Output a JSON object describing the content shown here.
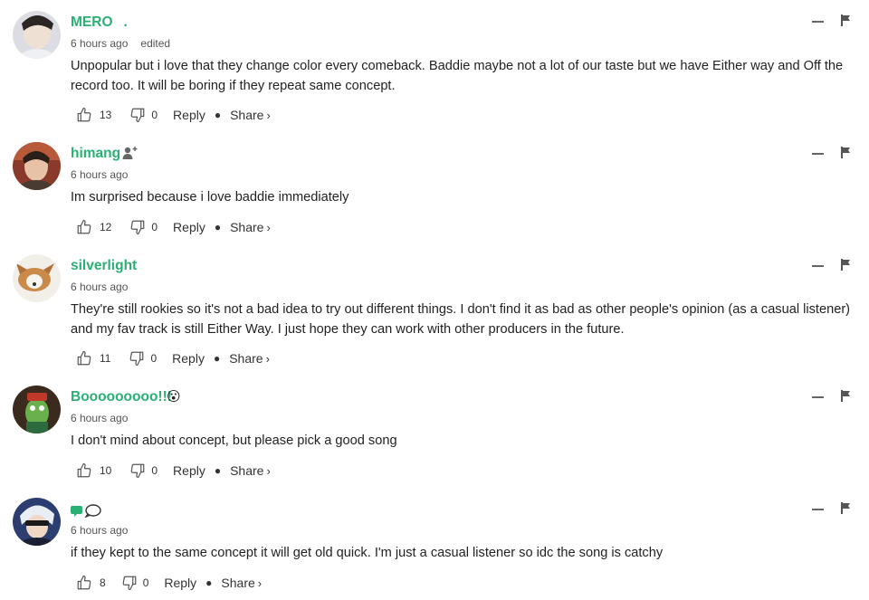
{
  "comments": [
    {
      "username": "MERO",
      "username_suffix": ".",
      "time": "6 hours ago",
      "edited": "edited",
      "text": "Unpopular but i love that they change color every comeback. Baddie maybe not a lot of our taste but we have Either way and Off the record too. It will be boring if they repeat same concept.",
      "likes": "13",
      "dislikes": "0",
      "reply_label": "Reply",
      "share_label": "Share",
      "share_chevron": "›"
    },
    {
      "username": "himang",
      "time": "6 hours ago",
      "text": "Im surprised because i love baddie immediately",
      "likes": "12",
      "dislikes": "0",
      "reply_label": "Reply",
      "share_label": "Share",
      "share_chevron": "›",
      "badge_icon": "add-friend-icon"
    },
    {
      "username": "silverlight",
      "time": "6 hours ago",
      "text": "They're still rookies so it's not a bad idea to try out different things. I don't find it as bad as other people's opinion (as a casual listener) and my fav track is still Either Way. I just hope they can work with other producers in the future.",
      "likes": "11",
      "dislikes": "0",
      "reply_label": "Reply",
      "share_label": "Share",
      "share_chevron": "›"
    },
    {
      "username": "Booooooooo!!!",
      "time": "6 hours ago",
      "text": "I don't mind about concept, but please pick a good song",
      "likes": "10",
      "dislikes": "0",
      "reply_label": "Reply",
      "share_label": "Share",
      "share_chevron": "›",
      "badge_icon": "surprised-face-emoji",
      "badge_glyph": "😮"
    },
    {
      "username": "",
      "time": "6 hours ago",
      "text": "if they kept to the same concept it will get old quick. I'm just a casual listener so idc the song is catchy",
      "likes": "8",
      "dislikes": "0",
      "reply_label": "Reply",
      "share_label": "Share",
      "share_chevron": "›",
      "badge_icon": "speech-bubbles-icon"
    }
  ],
  "colors": {
    "username": "#2aaf74",
    "text": "#222222",
    "meta": "#555555",
    "icon": "#555555"
  },
  "icons": {
    "like": "thumbs-up-icon",
    "dislike": "thumbs-down-icon",
    "collapse": "collapse-icon",
    "report": "flag-icon",
    "separator": "dot"
  }
}
